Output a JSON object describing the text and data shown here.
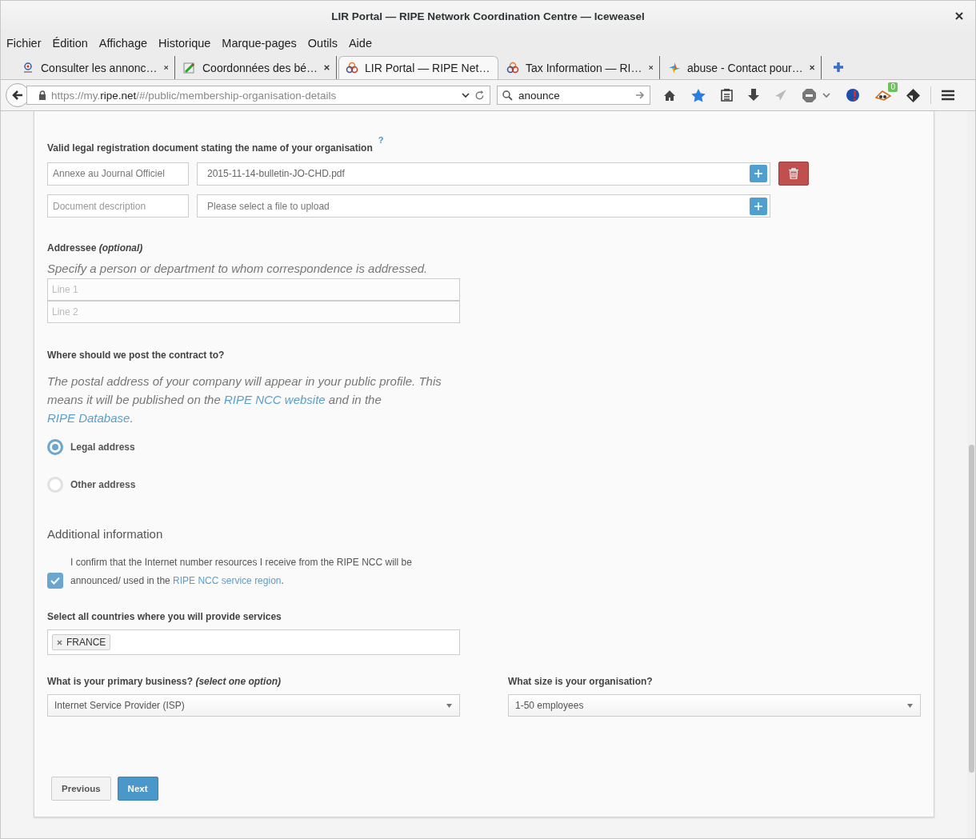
{
  "window": {
    "title": "LIR Portal — RIPE Network Coordination Centre — Iceweasel"
  },
  "menu": [
    "Fichier",
    "Édition",
    "Affichage",
    "Historique",
    "Marque-pages",
    "Outils",
    "Aide"
  ],
  "tabs": [
    {
      "title": "Consulter les annonc…",
      "selected": false
    },
    {
      "title": "Coordonnées des bé…",
      "selected": false
    },
    {
      "title": "LIR Portal — RIPE Net…",
      "selected": true
    },
    {
      "title": "Tax Information — RI…",
      "selected": false
    },
    {
      "title": "abuse - Contact pour…",
      "selected": false
    }
  ],
  "navbar": {
    "url": {
      "scheme": "https://my.",
      "host": "ripe.net",
      "path": "/#/public/membership-organisation-details"
    },
    "search": "anounce",
    "extension_badge": "0"
  },
  "documents": {
    "label": "Valid legal registration document stating the name of your organisation",
    "help": "?",
    "rows": [
      {
        "description": "Annexe au Journal Officiel",
        "description_placeholder": "",
        "file": "2015-11-14-bulletin-JO-CHD.pdf",
        "file_placeholder": "",
        "deletable": true
      },
      {
        "description": "",
        "description_placeholder": "Document description",
        "file": "",
        "file_placeholder": "Please select a file to upload",
        "deletable": false
      }
    ]
  },
  "addressee": {
    "label": "Addressee *(optional)*",
    "hint": "Specify a person or department to whom correspondence is addressed.",
    "lines": [
      {
        "placeholder": "Line 1"
      },
      {
        "placeholder": "Line 2"
      }
    ]
  },
  "contract": {
    "label": "Where should we post the contract to?",
    "text": [
      {
        "kind": "text",
        "text": "The postal address of your company will appear in your public profile. This means it will be published on the "
      },
      {
        "kind": "link",
        "text": "RIPE NCC website"
      },
      {
        "kind": "text",
        "text": " and in the "
      },
      {
        "kind": "link",
        "text": "RIPE Database"
      },
      {
        "kind": "text",
        "text": "."
      }
    ],
    "options": [
      {
        "label": "Legal address",
        "selected": true
      },
      {
        "label": "Other address",
        "selected": false
      }
    ]
  },
  "additional": {
    "heading": "Additional information",
    "confirm": {
      "checked": true,
      "text": [
        {
          "kind": "text",
          "text": "I confirm that the Internet number resources I receive from the RIPE NCC will be announced/ used in the "
        },
        {
          "kind": "link",
          "text": "RIPE NCC service region"
        },
        {
          "kind": "text",
          "text": "."
        }
      ]
    },
    "countries": {
      "label": "Select all countries where you will provide services",
      "tags": [
        "FRANCE"
      ]
    },
    "selects": [
      {
        "label": "What is your primary business? *(select one option)*",
        "value": "Internet Service Provider (ISP)"
      },
      {
        "label": "What size is your organisation?",
        "value": "1-50 employees"
      }
    ]
  },
  "buttons": [
    {
      "label": "Previous",
      "kind": "secondary"
    },
    {
      "label": "Next",
      "kind": "primary"
    }
  ]
}
